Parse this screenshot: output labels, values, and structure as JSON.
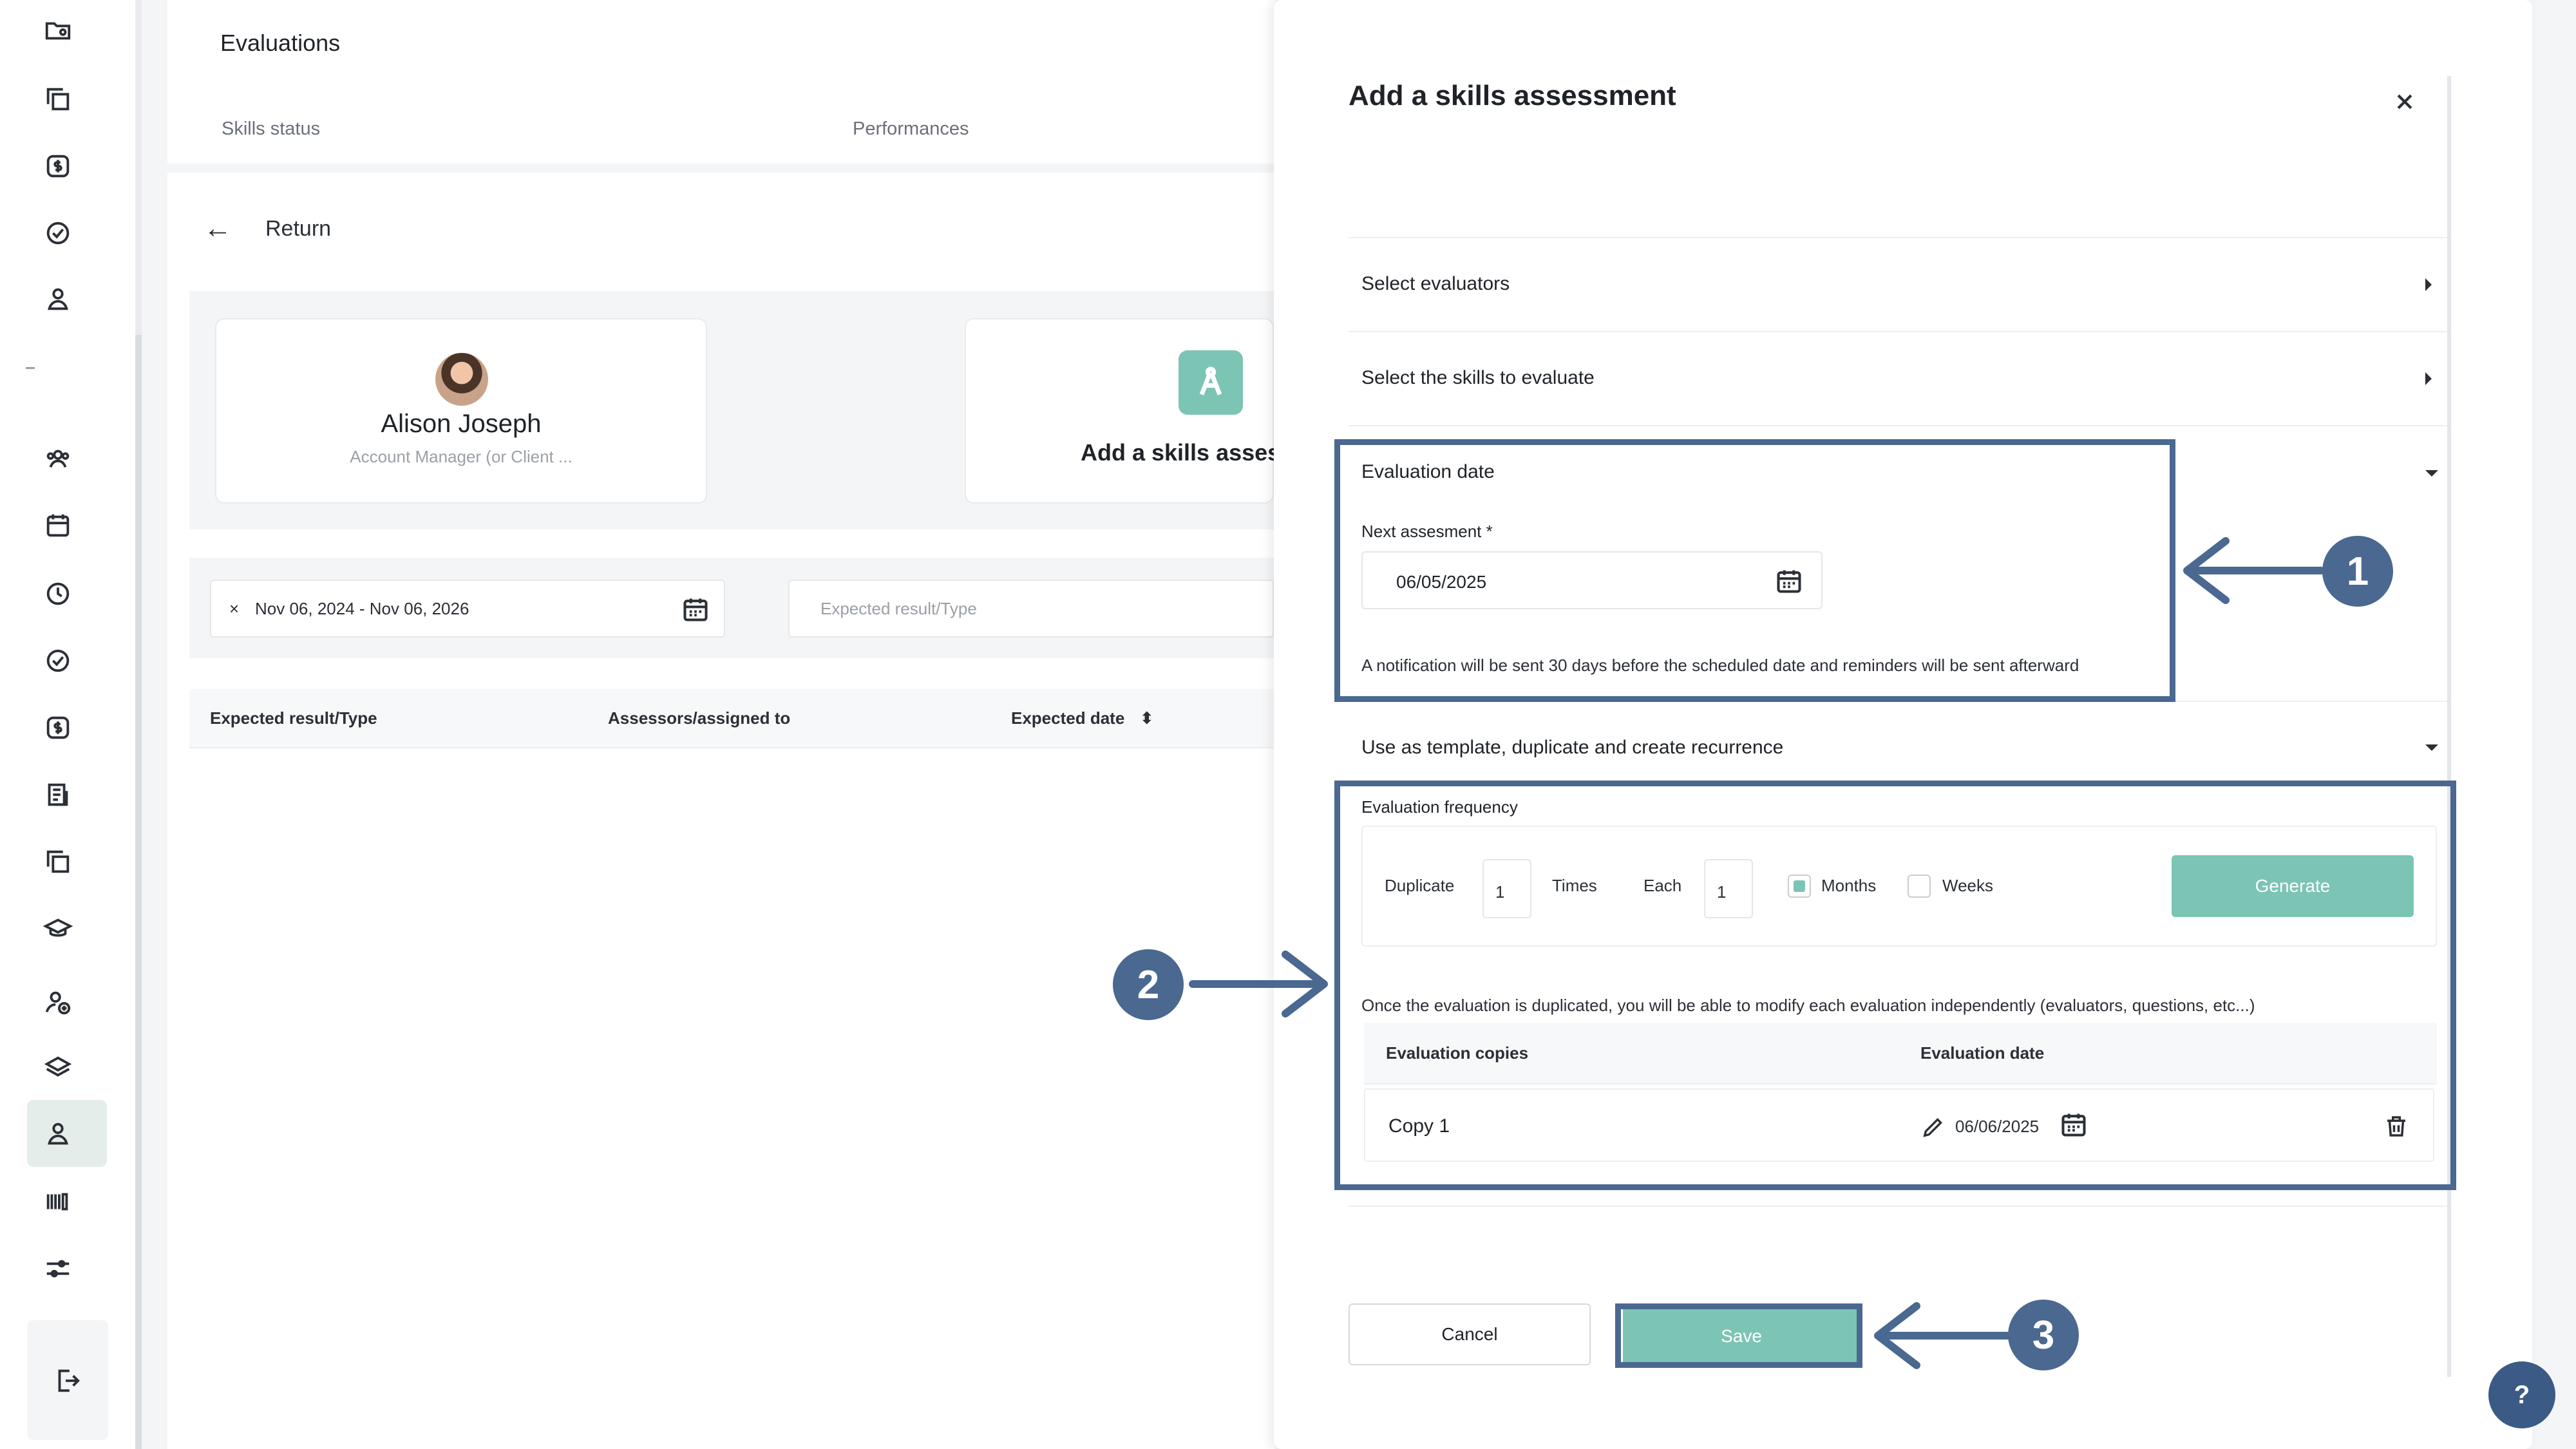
{
  "page": {
    "title": "Evaluations",
    "tabs": [
      "Skills status",
      "Performances"
    ],
    "return_label": "Return"
  },
  "employee": {
    "name": "Alison Joseph",
    "role": "Account Manager (or Client ..."
  },
  "add_card": {
    "label": "Add a skills asses"
  },
  "filters": {
    "date_range": "Nov 06, 2024 - Nov 06, 2026",
    "clear_symbol": "×",
    "type_placeholder": "Expected result/Type"
  },
  "table": {
    "headers": [
      "Expected result/Type",
      "Assessors/assigned to",
      "Expected date"
    ],
    "sort_symbol": "⬍"
  },
  "modal": {
    "title": "Add a skills assessment",
    "sections": {
      "evaluators": "Select evaluators",
      "skills": "Select the skills to evaluate",
      "date": "Evaluation date",
      "template": "Use as template, duplicate and create recurrence"
    },
    "next_assessment_label": "Next assesment *",
    "next_assessment_value": "06/05/2025",
    "notification_note": "A notification will be sent 30 days before the scheduled date and reminders will be sent afterward",
    "frequency": {
      "label": "Evaluation frequency",
      "duplicate_label": "Duplicate",
      "duplicate_value": "1",
      "times_label": "Times",
      "each_label": "Each",
      "each_value": "1",
      "months_label": "Months",
      "months_checked": true,
      "weeks_label": "Weeks",
      "weeks_checked": false,
      "generate_label": "Generate"
    },
    "duplicate_note": "Once the evaluation is duplicated, you will be able to modify each evaluation independently (evaluators, questions, etc...)",
    "copies": {
      "headers": [
        "Evaluation copies",
        "Evaluation date"
      ],
      "rows": [
        {
          "name": "Copy 1",
          "date": "06/06/2025"
        }
      ]
    },
    "cancel_label": "Cancel",
    "save_label": "Save"
  },
  "callouts": [
    "1",
    "2",
    "3"
  ],
  "help_label": "?",
  "colors": {
    "accent": "#7cc4b3",
    "callout": "#4a6890",
    "help": "#3b5a86"
  }
}
